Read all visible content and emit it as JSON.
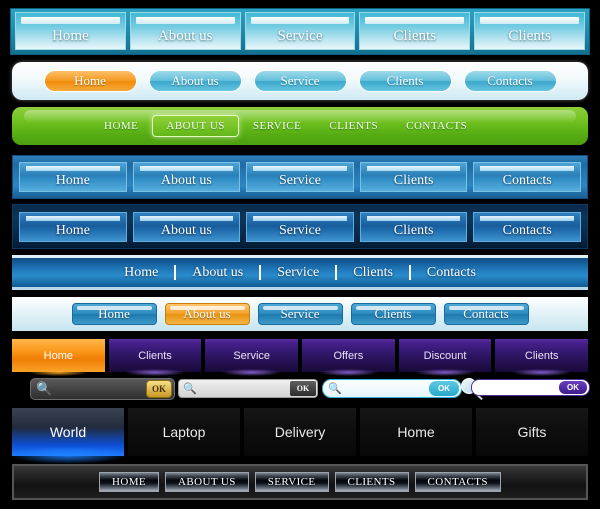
{
  "bar1": {
    "style_name": "light-cyan-tabs",
    "items": [
      {
        "label": "Home",
        "active": true
      },
      {
        "label": "About us",
        "active": false
      },
      {
        "label": "Service",
        "active": false
      },
      {
        "label": "Clients",
        "active": false
      },
      {
        "label": "Clients",
        "active": false
      }
    ]
  },
  "bar2": {
    "style_name": "white-rounded-pills",
    "items": [
      {
        "label": "Home",
        "active": true
      },
      {
        "label": "About us",
        "active": false
      },
      {
        "label": "Service",
        "active": false
      },
      {
        "label": "Clients",
        "active": false
      },
      {
        "label": "Contacts",
        "active": false
      }
    ]
  },
  "bar3": {
    "style_name": "green-bar",
    "items": [
      {
        "label": "HOME",
        "active": false
      },
      {
        "label": "ABOUT US",
        "active": true
      },
      {
        "label": "SERVICE",
        "active": false
      },
      {
        "label": "CLIENTS",
        "active": false
      },
      {
        "label": "CONTACTS",
        "active": false
      }
    ]
  },
  "bar4": {
    "style_name": "medium-blue-tabs",
    "items": [
      {
        "label": "Home",
        "active": false
      },
      {
        "label": "About us",
        "active": false
      },
      {
        "label": "Service",
        "active": false
      },
      {
        "label": "Clients",
        "active": false
      },
      {
        "label": "Contacts",
        "active": false
      }
    ]
  },
  "bar5": {
    "style_name": "dark-blue-tabs",
    "items": [
      {
        "label": "Home",
        "active": false
      },
      {
        "label": "About us",
        "active": false
      },
      {
        "label": "Service",
        "active": false
      },
      {
        "label": "Clients",
        "active": false
      },
      {
        "label": "Contacts",
        "active": false
      }
    ]
  },
  "bar6": {
    "style_name": "blue-strip-separators",
    "items": [
      {
        "label": "Home",
        "active": false
      },
      {
        "label": "About us",
        "active": false
      },
      {
        "label": "Service",
        "active": false
      },
      {
        "label": "Clients",
        "active": false
      },
      {
        "label": "Contacts",
        "active": false
      }
    ]
  },
  "bar7": {
    "style_name": "pale-strip-blue-buttons",
    "items": [
      {
        "label": "Home",
        "active": false
      },
      {
        "label": "About us",
        "active": true
      },
      {
        "label": "Service",
        "active": false
      },
      {
        "label": "Clients",
        "active": false
      },
      {
        "label": "Contacts",
        "active": false
      }
    ]
  },
  "bar8": {
    "style_name": "purple-blocks",
    "items": [
      {
        "label": "Home",
        "active": true
      },
      {
        "label": "Clients",
        "active": false
      },
      {
        "label": "Service",
        "active": false
      },
      {
        "label": "Offers",
        "active": false
      },
      {
        "label": "Discount",
        "active": false
      },
      {
        "label": "Clients",
        "active": false
      }
    ]
  },
  "search_bars": [
    {
      "style_name": "dark-gold-ok",
      "value": "",
      "placeholder": "",
      "button_label": "OK",
      "icon": "magnifier-icon"
    },
    {
      "style_name": "silver-dark-ok",
      "value": "",
      "placeholder": "",
      "button_label": "OK",
      "icon": "magnifier-icon"
    },
    {
      "style_name": "cyan-rounded-ok",
      "value": "",
      "placeholder": "",
      "button_label": "OK",
      "icon": "magnifier-icon"
    },
    {
      "style_name": "white-purple-ok",
      "value": "",
      "placeholder": "",
      "button_label": "OK",
      "icon": "magnifier-icon"
    }
  ],
  "bar9": {
    "style_name": "black-tabs-blue-glow",
    "items": [
      {
        "label": "World",
        "active": true
      },
      {
        "label": "Laptop",
        "active": false
      },
      {
        "label": "Delivery",
        "active": false
      },
      {
        "label": "Home",
        "active": false
      },
      {
        "label": "Gifts",
        "active": false
      }
    ]
  },
  "bar10": {
    "style_name": "dark-metallic-bar",
    "items": [
      {
        "label": "HOME",
        "active": false
      },
      {
        "label": "ABOUT US",
        "active": false
      },
      {
        "label": "SERVICE",
        "active": false
      },
      {
        "label": "CLIENTS",
        "active": false
      },
      {
        "label": "CONTACTS",
        "active": false
      }
    ]
  },
  "colors": {
    "background": "#000000",
    "cyan": "#2ba3c4",
    "orange": "#f59a22",
    "green": "#72c322",
    "blue": "#2a8ccb",
    "dark_blue": "#0d3557",
    "purple": "#45208a",
    "glow_blue": "#1e7bff",
    "gold": "#c79a23"
  }
}
